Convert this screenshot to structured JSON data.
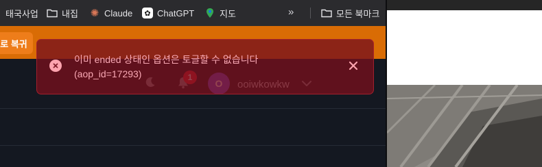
{
  "bookmarks": [
    {
      "label": "태국사업",
      "icon": "folder-icon"
    },
    {
      "label": "내집",
      "icon": "folder-icon"
    },
    {
      "label": "Claude",
      "icon": "claude-icon"
    },
    {
      "label": "ChatGPT",
      "icon": "chatgpt-icon"
    },
    {
      "label": "지도",
      "icon": "maps-icon"
    }
  ],
  "overflow": "»",
  "all_bookmarks": {
    "label": "모든 북마크",
    "icon": "folder-icon"
  },
  "toolbar": {
    "restore_label": "로 복귀"
  },
  "header": {
    "notification_count": "1",
    "user": {
      "initial": "O",
      "name": "ooiwkowkw"
    }
  },
  "toast": {
    "line1": "이미 ended 상태인 옵션은 토글할 수 없습니다",
    "line2": "(aop_id=17293)"
  },
  "colors": {
    "accent_orange": "#d96c05",
    "error_red": "#a3202c",
    "badge_red": "#e5232f",
    "avatar_purple": "#6b4de0"
  }
}
